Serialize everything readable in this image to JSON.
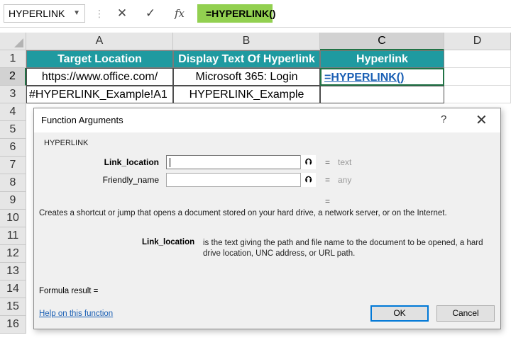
{
  "formula_bar": {
    "name_box": "HYPERLINK",
    "cancel_glyph": "✕",
    "enter_glyph": "✓",
    "fx_label": "fx",
    "formula": "=HYPERLINK()"
  },
  "columns": [
    "A",
    "B",
    "C",
    "D"
  ],
  "rows": [
    "1",
    "2",
    "3",
    "4",
    "5",
    "6",
    "7",
    "8",
    "9",
    "10",
    "11",
    "12",
    "13",
    "14",
    "15",
    "16"
  ],
  "table": {
    "headers": [
      "Target Location",
      "Display Text Of Hyperlink",
      "Hyperlink"
    ],
    "row2": [
      "https://www.office.com/",
      "Microsoft 365: Login",
      "=HYPERLINK()"
    ],
    "row3": [
      "#HYPERLINK_Example!A1",
      "HYPERLINK_Example",
      ""
    ]
  },
  "dialog": {
    "title": "Function Arguments",
    "help_glyph": "?",
    "close_glyph": "✕",
    "function_name": "HYPERLINK",
    "args": [
      {
        "label": "Link_location",
        "value": "",
        "collapse_glyph": "⮉",
        "eq": "=",
        "type": "text"
      },
      {
        "label": "Friendly_name",
        "value": "",
        "collapse_glyph": "⮉",
        "eq": "=",
        "type": "any"
      }
    ],
    "result_eq": "=",
    "description": "Creates a shortcut or jump that opens a document stored on your hard drive, a network server, or on the Internet.",
    "arg_desc_label": "Link_location",
    "arg_desc_text": "is the text giving the path and file name to the document to be opened, a hard drive location, UNC address, or URL path.",
    "formula_result": "Formula result =",
    "help_link": "Help on this function",
    "ok": "OK",
    "cancel": "Cancel"
  },
  "colors": {
    "header_fill": "#1f9aa0",
    "formula_chip": "#92d050",
    "selection": "#217346",
    "link": "#1a5fb4"
  }
}
